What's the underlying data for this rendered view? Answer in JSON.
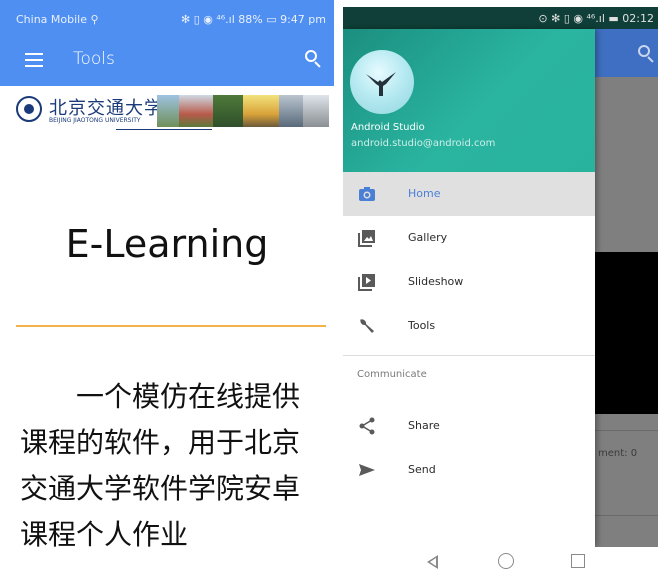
{
  "left_phone": {
    "status_bar": {
      "carrier": "China Mobile ⚲",
      "right_text": "✻ ▯ ◉ ⁴⁶.ıl 88% ▭ 9:47 pm"
    },
    "toolbar": {
      "title": "Tools"
    },
    "banner": {
      "university_cn": "北京交通大学",
      "university_en": "BEIJING JIAOTONG UNIVERSITY"
    },
    "app_title": "E-Learning",
    "description": "一个模仿在线提供课程的软件，用于北京交通大学软件学院安卓课程个人作业"
  },
  "right_phone": {
    "status_bar": {
      "time_text": "⊙ ✻ ▯ ◉ ⁴⁶.ıl ▬ 02:12"
    },
    "drawer": {
      "user_name": "Android Studio",
      "user_email": "android.studio@android.com",
      "items": [
        {
          "label": "Home",
          "icon": "camera-icon",
          "active": true
        },
        {
          "label": "Gallery",
          "icon": "gallery-icon",
          "active": false
        },
        {
          "label": "Slideshow",
          "icon": "slideshow-icon",
          "active": false
        },
        {
          "label": "Tools",
          "icon": "wrench-icon",
          "active": false
        }
      ],
      "section_label": "Communicate",
      "communicate_items": [
        {
          "label": "Share",
          "icon": "share-icon"
        },
        {
          "label": "Send",
          "icon": "send-icon"
        }
      ]
    },
    "background": {
      "comment_fragment": "ment:  0"
    }
  },
  "colors": {
    "primary": "#4f8ff2",
    "accent_line": "#f2b24a",
    "drawer_header": "#2ab5a1",
    "active_label": "#4a7fd6"
  }
}
